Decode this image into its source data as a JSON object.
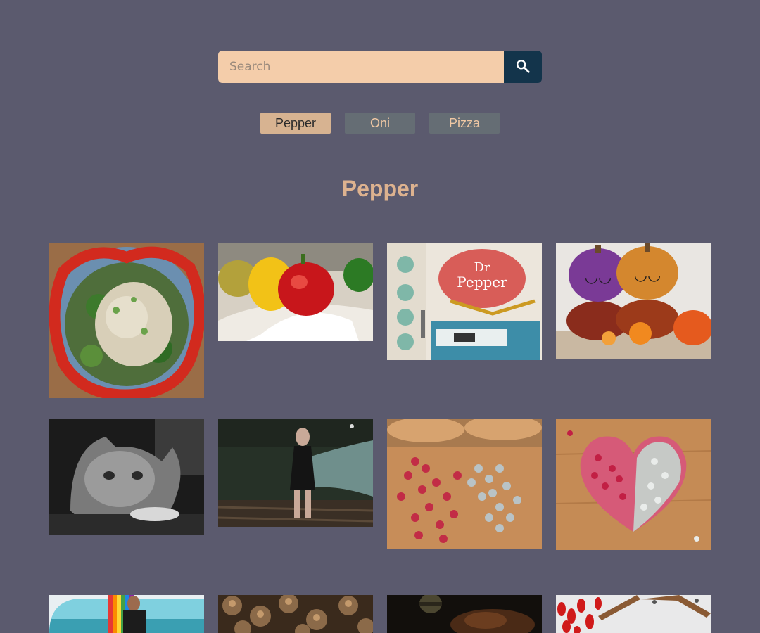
{
  "search": {
    "placeholder": "Search",
    "value": ""
  },
  "search_button": {
    "icon": "search-icon"
  },
  "tabs": [
    {
      "label": "Pepper",
      "active": true
    },
    {
      "label": "Oni",
      "active": false
    },
    {
      "label": "Pizza",
      "active": false
    }
  ],
  "heading": "Pepper",
  "colors": {
    "background": "#5b5a6e",
    "search_field": "#f4cdaa",
    "search_button": "#13344b",
    "active_tab": "#d7b391",
    "inactive_tab": "#656d74",
    "heading": "#ddb28f"
  },
  "gallery": [
    {
      "subject": "pepper salad"
    },
    {
      "subject": "bell peppers"
    },
    {
      "subject": "dr pepper sign"
    },
    {
      "subject": "glitter pumpkins"
    },
    {
      "subject": "black and white cat"
    },
    {
      "subject": "game character by water"
    },
    {
      "subject": "pink and white peppercorns"
    },
    {
      "subject": "peppercorn heart"
    },
    {
      "subject": "avatar with rainbow"
    },
    {
      "subject": "dried pods close-up"
    },
    {
      "subject": "dark food photo"
    },
    {
      "subject": "hanging red chilies"
    }
  ]
}
